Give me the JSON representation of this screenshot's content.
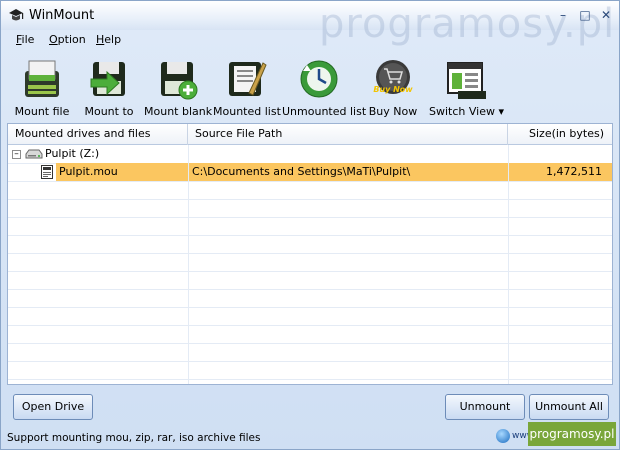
{
  "window": {
    "title": "WinMount"
  },
  "watermark": "programosy.pl",
  "menu": [
    {
      "label": "File",
      "accel": "F",
      "rest": "ile"
    },
    {
      "label": "Option",
      "accel": "O",
      "rest": "ption"
    },
    {
      "label": "Help",
      "accel": "H",
      "rest": "elp"
    }
  ],
  "toolbar": {
    "items": [
      {
        "label": "Mount file"
      },
      {
        "label": "Mount to"
      },
      {
        "label": "Mount blank"
      },
      {
        "label": "Mounted list"
      },
      {
        "label": "Unmounted list"
      },
      {
        "label": "Buy Now",
        "badge": "Buy Now"
      },
      {
        "label": "Switch View ▾"
      }
    ]
  },
  "table": {
    "columns": [
      "Mounted drives and files",
      "Source File Path",
      "Size(in bytes)"
    ],
    "drive": {
      "label": "Pulpit (Z:)"
    },
    "rows": [
      {
        "name": "Pulpit.mou",
        "path": "C:\\Documents and Settings\\MaTi\\Pulpit\\",
        "size": "1,472,511"
      }
    ]
  },
  "buttons": {
    "open_drive": "Open Drive",
    "unmount": "Unmount",
    "unmount_all": "Unmount All"
  },
  "status": {
    "text": "Support mounting mou, zip, rar, iso archive files",
    "url_partial": "www."
  },
  "colors": {
    "selection": "#fbc660",
    "accent": "#2b5fa8",
    "badge": "#79a63a"
  }
}
